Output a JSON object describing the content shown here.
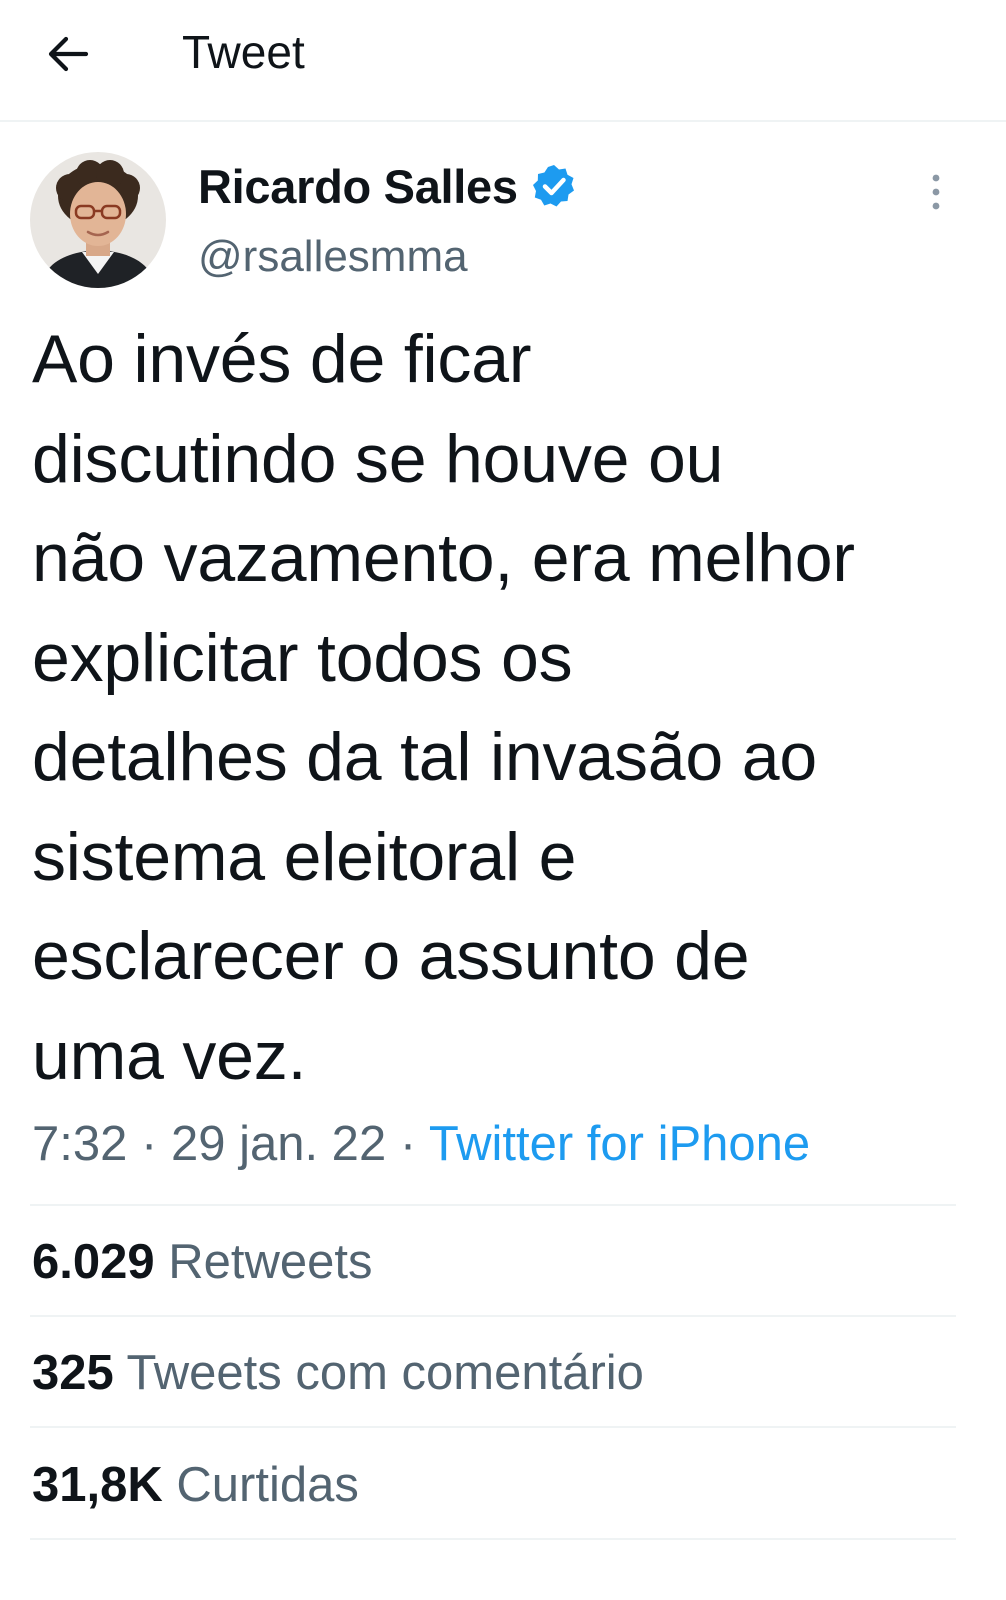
{
  "header": {
    "title": "Tweet",
    "back_icon": "arrow-left-icon"
  },
  "author": {
    "display_name": "Ricardo Salles",
    "handle": "@rsallesmma",
    "verified": true,
    "verified_color": "#1d9bf0"
  },
  "tweet": {
    "lines": [
      "Ao invés de ficar",
      "discutindo se houve ou",
      "não vazamento, era melhor",
      "explicitar todos os",
      "detalhes da tal invasão ao",
      "sistema eleitoral e",
      "esclarecer o assunto de",
      "uma vez."
    ],
    "time": "7:32",
    "date": "29 jan. 22",
    "separator": "·",
    "source": "Twitter for iPhone"
  },
  "stats": [
    {
      "count": "6.029",
      "label": "Retweets"
    },
    {
      "count": "325",
      "label": "Tweets com comentário"
    },
    {
      "count": "31,8K",
      "label": "Curtidas"
    }
  ],
  "colors": {
    "text_primary": "#0f1419",
    "text_secondary": "#536471",
    "accent": "#1d9bf0",
    "divider": "#eff3f4"
  }
}
